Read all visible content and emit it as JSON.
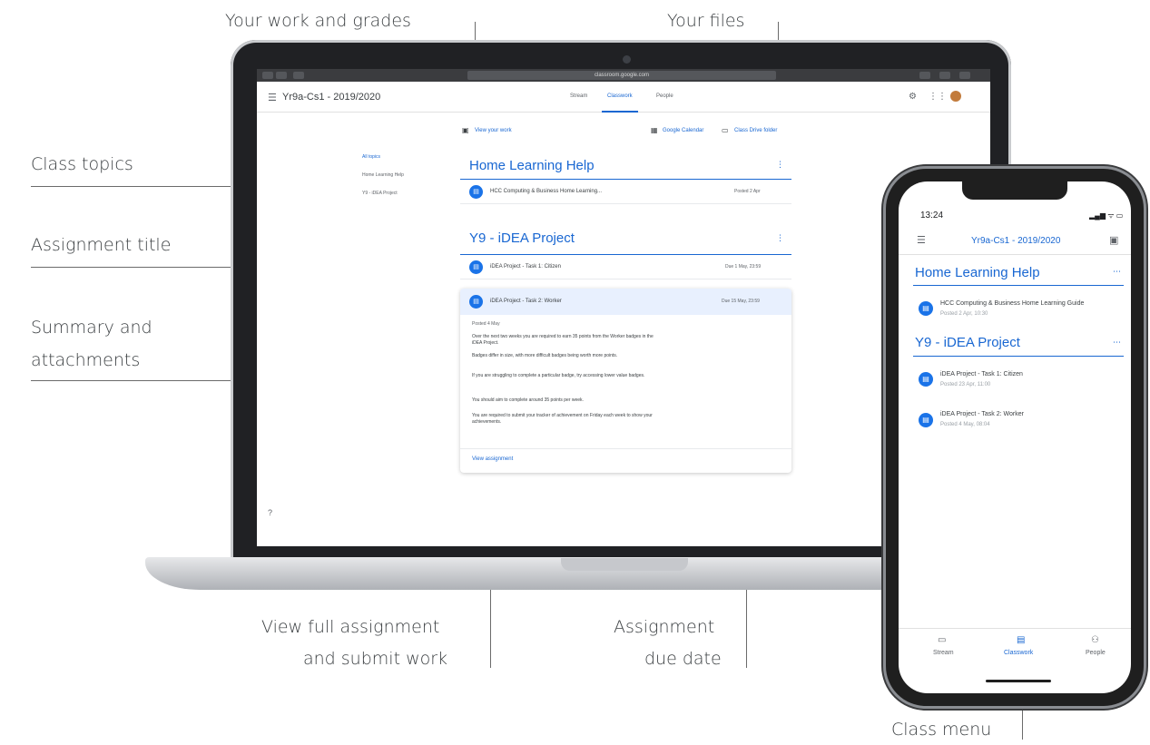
{
  "callouts": {
    "your_work": "Your work and grades",
    "your_files": "Your files",
    "class_topics": "Class topics",
    "assignment_title": "Assignment title",
    "summary_1": "Summary and",
    "summary_2": "attachments",
    "view_full_1": "View full assignment",
    "view_full_2": "and submit work",
    "due_1": "Assignment",
    "due_2": "due date",
    "class_menu": "Class menu"
  },
  "browser": {
    "url": "classroom.google.com"
  },
  "header": {
    "menu_icon": "hamburger-menu-icon",
    "title": "Yr9a-Cs1 - 2019/2020",
    "tabs": [
      {
        "label": "Stream"
      },
      {
        "label": "Classwork"
      },
      {
        "label": "People"
      }
    ]
  },
  "sidebar": {
    "topics": [
      {
        "label": "All topics"
      },
      {
        "label": "Home Learning Help"
      },
      {
        "label": "Y9 - iDEA Project"
      }
    ]
  },
  "toolbar": {
    "view_work": "View your work",
    "calendar": "Google Calendar",
    "drive": "Class Drive folder"
  },
  "sections": [
    {
      "title": "Home Learning Help",
      "items": [
        {
          "title": "HCC Computing & Business Home Learning...",
          "meta": "Posted 2 Apr"
        }
      ]
    },
    {
      "title": "Y9 - iDEA Project",
      "items": [
        {
          "title": "iDEA Project - Task 1: Citizen",
          "meta": "Due 1 May, 23:59"
        },
        {
          "title": "iDEA Project - Task 2: Worker",
          "meta": "Due 15 May, 23:59"
        }
      ]
    }
  ],
  "expanded": {
    "posted": "Posted 4 May",
    "paragraphs": [
      "Over the next two weeks you are required to earn 35 points from the Worker badges in the iDEA Project.",
      "Badges differ in size, with more difficult badges being worth more points.",
      "If you are struggling to complete a particular badge, try accessing lower value badges.",
      "You should aim to complete around 35 points per week.",
      "You are required to submit your tracker of achievement on Friday each week to show your achievements."
    ],
    "link": "View assignment"
  },
  "phone": {
    "time": "13:24",
    "status": "▂▄▆ ᯤ ▭",
    "title": "Yr9a-Cs1 - 2019/2020",
    "sections": [
      {
        "title": "Home Learning Help",
        "items": [
          {
            "title": "HCC Computing & Business Home Learning Guide",
            "sub": "Posted 2 Apr, 10:30"
          }
        ]
      },
      {
        "title": "Y9 - iDEA Project",
        "items": [
          {
            "title": "iDEA Project - Task 1: Citizen",
            "sub": "Posted 23 Apr, 11:00"
          },
          {
            "title": "iDEA Project - Task 2: Worker",
            "sub": "Posted 4 May, 08:04"
          }
        ]
      }
    ],
    "nav": [
      {
        "label": "Stream"
      },
      {
        "label": "Classwork"
      },
      {
        "label": "People"
      }
    ]
  },
  "colors": {
    "accent": "#1967d2",
    "icon_blue": "#1a73e8",
    "selected_row": "#e8f0fe"
  }
}
